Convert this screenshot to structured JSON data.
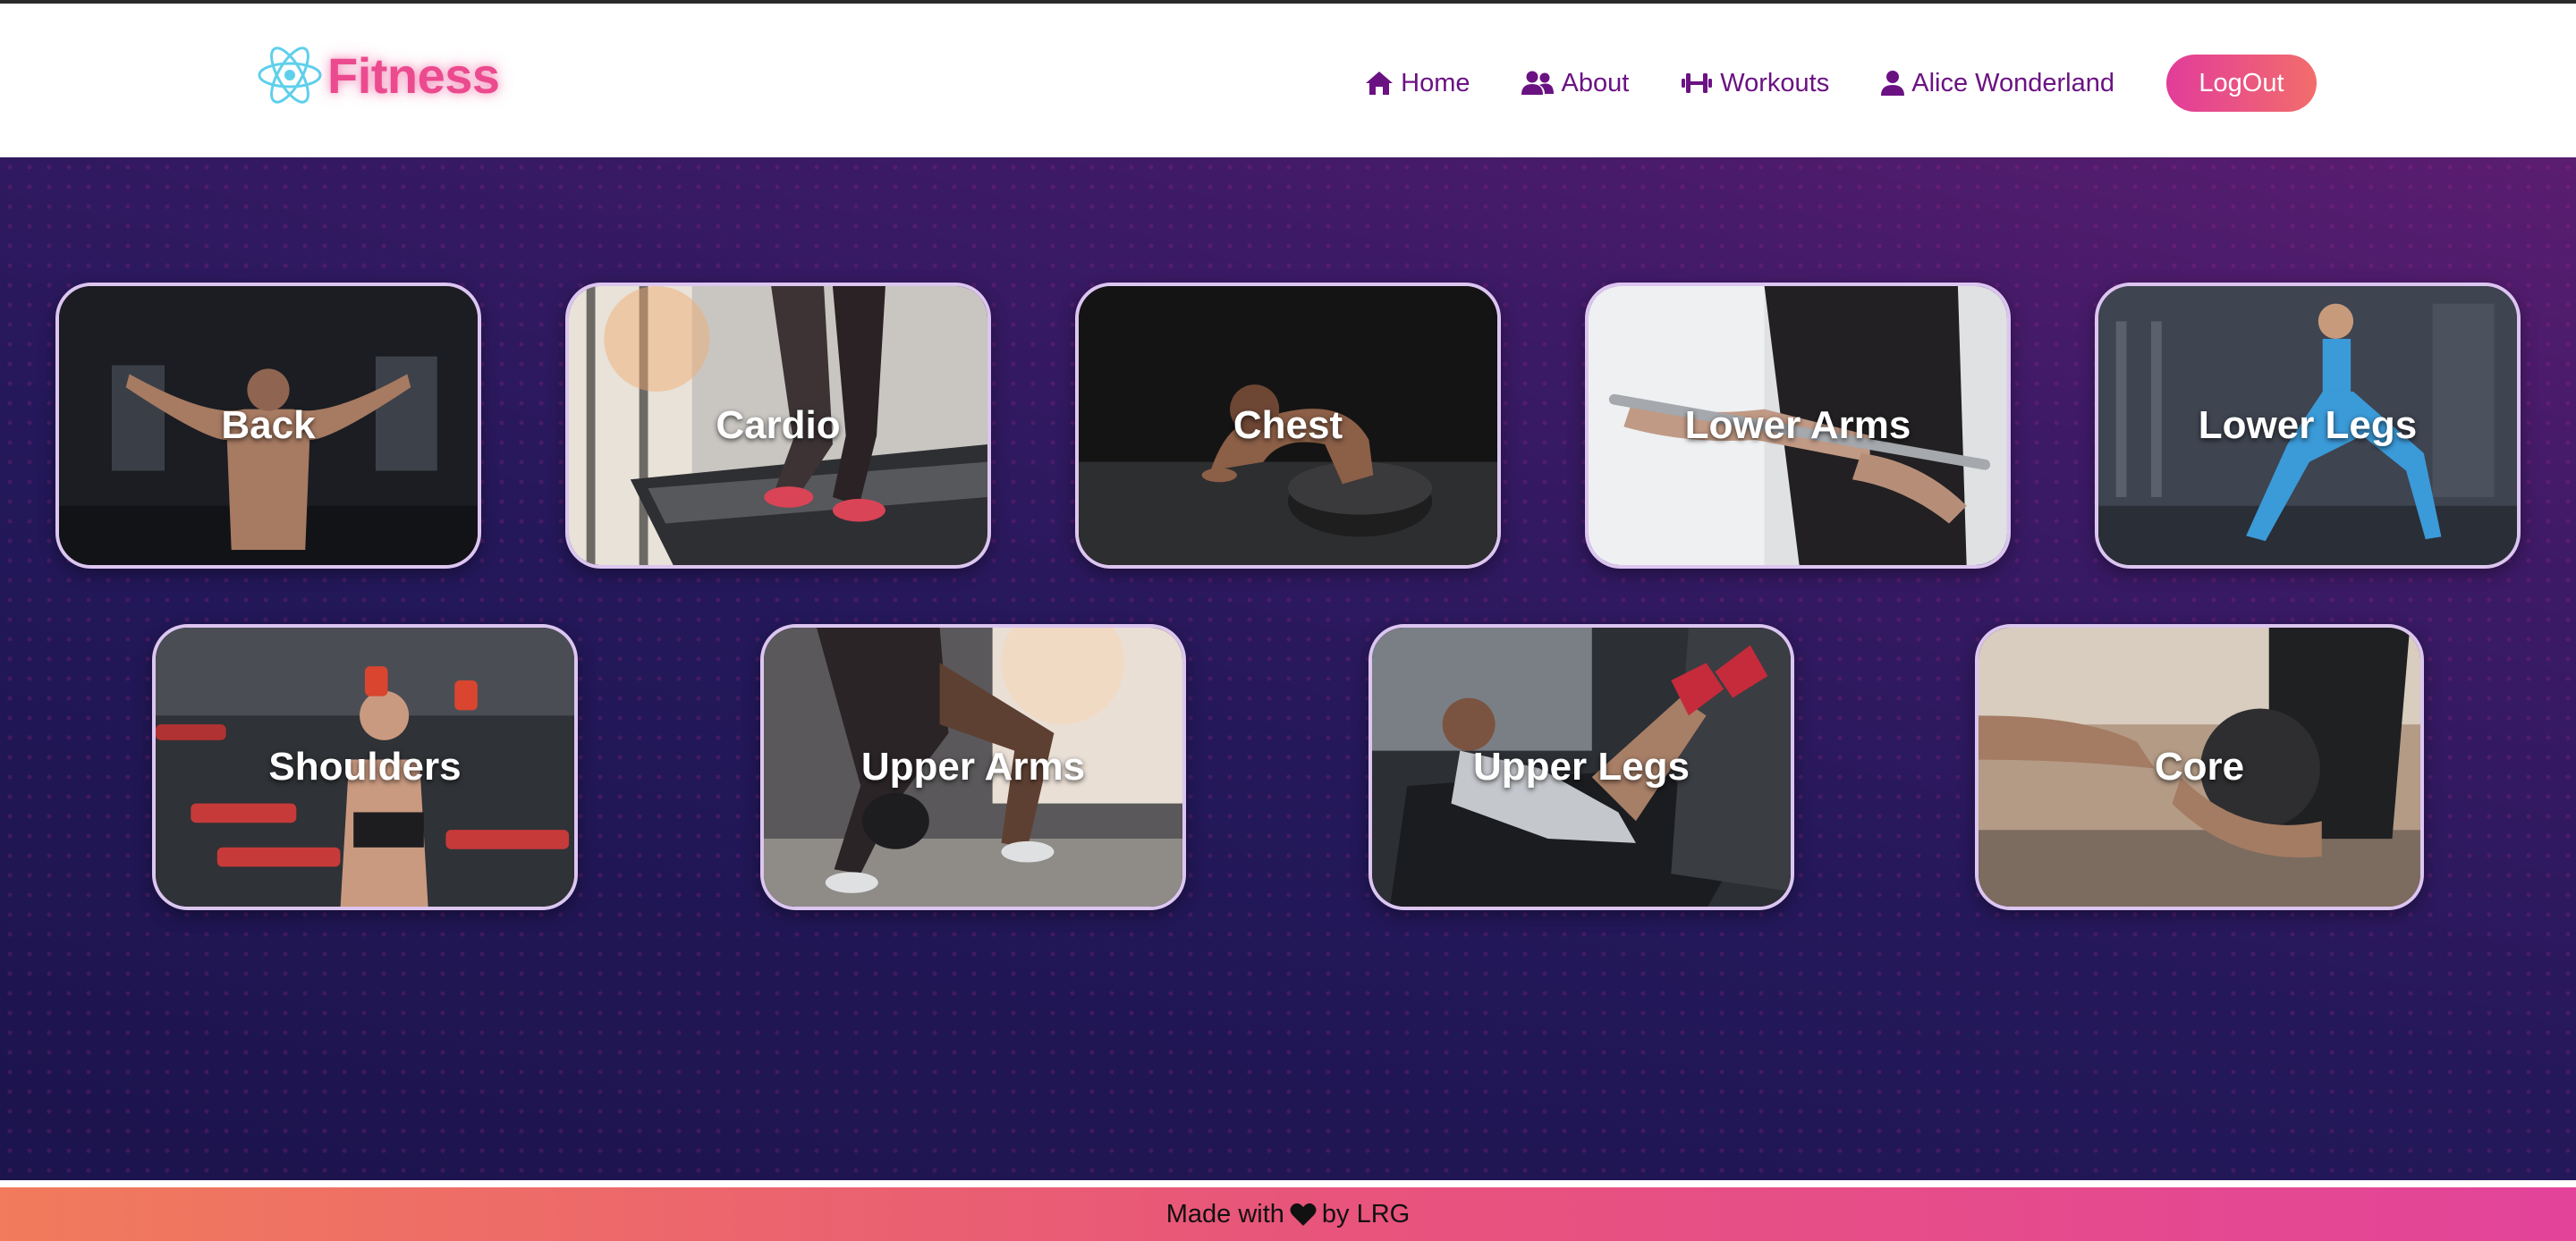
{
  "brand": {
    "name": "Fitness",
    "icon": "atom-icon",
    "color": "#ec4a8f"
  },
  "nav": {
    "links": [
      {
        "label": "Home",
        "icon": "home-icon"
      },
      {
        "label": "About",
        "icon": "users-icon"
      },
      {
        "label": "Workouts",
        "icon": "dumbbell-icon"
      },
      {
        "label": "Alice Wonderland",
        "icon": "user-icon"
      }
    ],
    "logout_label": "LogOut"
  },
  "categories": [
    {
      "label": "Back"
    },
    {
      "label": "Cardio"
    },
    {
      "label": "Chest"
    },
    {
      "label": "Lower Arms"
    },
    {
      "label": "Lower Legs"
    },
    {
      "label": "Shoulders"
    },
    {
      "label": "Upper Arms"
    },
    {
      "label": "Upper Legs"
    },
    {
      "label": "Core"
    }
  ],
  "footer": {
    "prefix": "Made with",
    "icon": "heart-icon",
    "suffix": "by LRG"
  }
}
